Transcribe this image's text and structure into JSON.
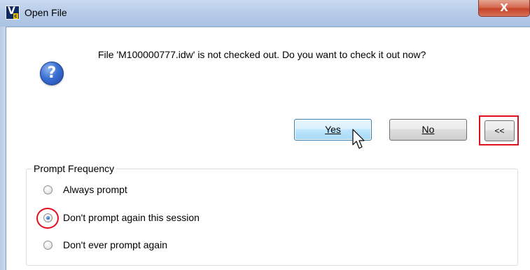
{
  "window": {
    "title": "Open File",
    "close_glyph": "X",
    "app_icon_letter": "V",
    "app_icon_sub": "c"
  },
  "dialog": {
    "icon": "question-icon",
    "message": "File 'M100000777.idw' is not checked out. Do you want to check it out now?"
  },
  "buttons": {
    "yes_label": "Yes",
    "no_label": "No",
    "collapse_label": "<<"
  },
  "prompt_frequency": {
    "legend": "Prompt Frequency",
    "options": [
      {
        "label": "Always prompt",
        "checked": false
      },
      {
        "label": "Don't prompt again this session",
        "checked": true
      },
      {
        "label": "Don't ever prompt again",
        "checked": false
      }
    ]
  },
  "colors": {
    "highlight": "#e0101e",
    "default_button_border": "#3c7fb1"
  }
}
